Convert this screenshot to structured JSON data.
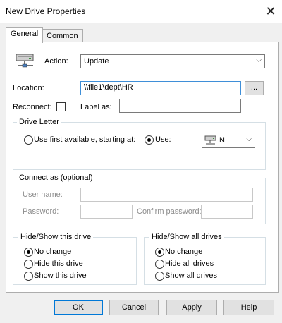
{
  "window": {
    "title": "New Drive Properties",
    "close_glyph": "✕"
  },
  "tabs": [
    {
      "label": "General"
    },
    {
      "label": "Common"
    }
  ],
  "general": {
    "action_label": "Action:",
    "action_value": "Update",
    "location_label": "Location:",
    "location_value": "\\\\file1\\dept\\HR",
    "browse_label": "...",
    "reconnect_label": "Reconnect:",
    "label_as_label": "Label as:",
    "label_as_value": ""
  },
  "drive_letter": {
    "group_label": "Drive Letter",
    "first_available_label": "Use first available, starting at:",
    "use_label": "Use:",
    "drive_value": "N"
  },
  "connect_as": {
    "group_label": "Connect as (optional)",
    "user_name_label": "User name:",
    "password_label": "Password:",
    "confirm_password_label": "Confirm password:"
  },
  "hide_show_drive": {
    "group_label": "Hide/Show this drive",
    "options": [
      "No change",
      "Hide this drive",
      "Show this drive"
    ],
    "selected": "No change"
  },
  "hide_show_all": {
    "group_label": "Hide/Show all drives",
    "options": [
      "No change",
      "Hide all drives",
      "Show all drives"
    ],
    "selected": "No change"
  },
  "buttons": {
    "ok": "OK",
    "cancel": "Cancel",
    "apply": "Apply",
    "help": "Help"
  },
  "icons": {
    "action_icon": "network-drive-icon",
    "drive_icon": "network-drive-icon"
  },
  "colors": {
    "focus_border": "#3f8fd8",
    "default_button_border": "#0078d7"
  }
}
